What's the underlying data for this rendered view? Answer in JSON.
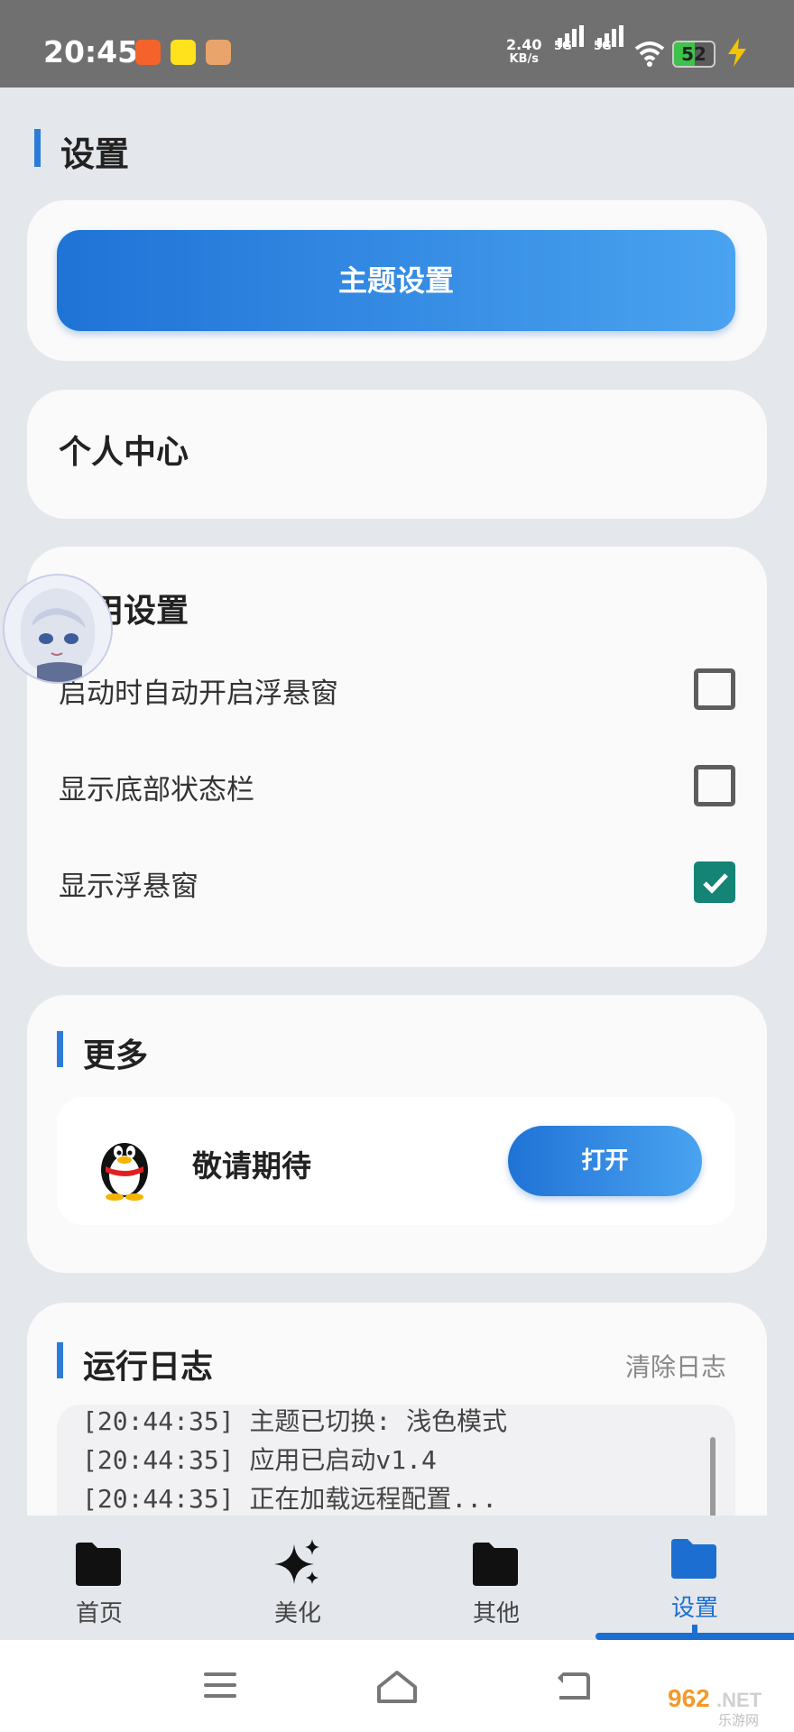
{
  "status_bar": {
    "time": "20:45",
    "net_speed_value": "2.40",
    "net_speed_unit": "KB/s",
    "sim1": "5G",
    "sim2": "5G",
    "battery_level": "52",
    "battery_fraction": 0.52,
    "app_icons": [
      "taobao-icon",
      "xianyu-icon",
      "game-icon"
    ]
  },
  "page": {
    "title": "设置"
  },
  "theme_card": {
    "button_label": "主题设置"
  },
  "profile_card": {
    "title": "个人中心"
  },
  "app_settings": {
    "title": "应用设置",
    "options": [
      {
        "label": "启动时自动开启浮悬窗",
        "checked": false
      },
      {
        "label": "显示底部状态栏",
        "checked": false
      },
      {
        "label": "显示浮悬窗",
        "checked": true
      }
    ]
  },
  "more": {
    "title": "更多",
    "item_label": "敬请期待",
    "open_button": "打开"
  },
  "log": {
    "title": "运行日志",
    "clear_label": "清除日志",
    "lines": [
      "[20:44:35] 主题已切换: 浅色模式",
      "[20:44:35] 应用已启动v1.4",
      "[20:44:35] 正在加载远程配置..."
    ]
  },
  "bottom_nav": {
    "items": [
      {
        "label": "首页",
        "icon": "folder-icon"
      },
      {
        "label": "美化",
        "icon": "sparkle-icon"
      },
      {
        "label": "其他",
        "icon": "folder-icon"
      },
      {
        "label": "设置",
        "icon": "folder-icon",
        "active": true
      }
    ]
  },
  "watermark": {
    "text": "962.NET",
    "subtext": "乐游网"
  },
  "colors": {
    "accent": "#2c7bd8",
    "checkbox_checked": "#138476",
    "background": "#e4e7ec",
    "card": "#fafafa"
  }
}
